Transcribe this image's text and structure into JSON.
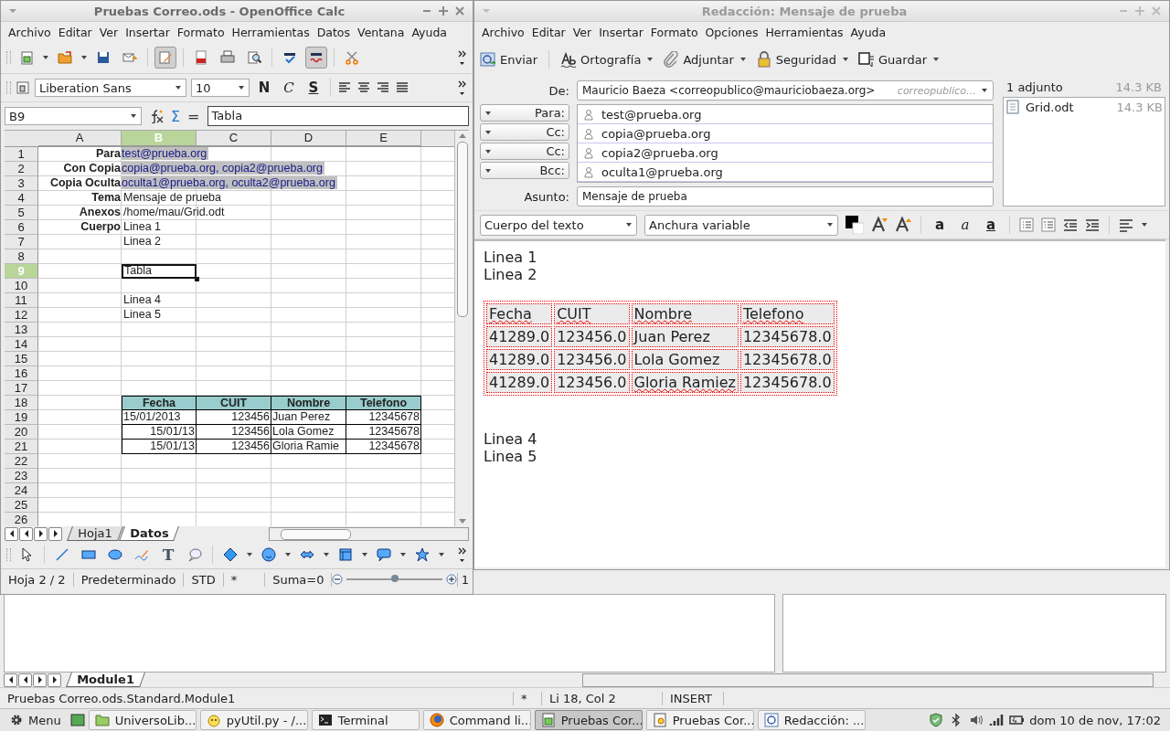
{
  "ide": {
    "tabs": [
      {
        "label": "Module1",
        "selected": true
      }
    ],
    "status": [
      "Pruebas Correo.ods.Standard.Module1",
      "*",
      "Li 18, Col 2",
      "INSERT"
    ]
  },
  "calc": {
    "title": "Pruebas Correo.ods - OpenOffice Calc",
    "menu": [
      "Archivo",
      "Editar",
      "Ver",
      "Insertar",
      "Formato",
      "Herramientas",
      "Datos",
      "Ventana",
      "Ayuda"
    ],
    "toolbar": [
      {
        "kind": "new",
        "pressed": false,
        "dropdown": true
      },
      {
        "kind": "open",
        "pressed": false,
        "dropdown": true
      },
      {
        "kind": "save",
        "pressed": false,
        "dropdown": false
      },
      {
        "kind": "mail",
        "pressed": false,
        "dropdown": false
      },
      {
        "kind": "edit",
        "pressed": true,
        "dropdown": false
      },
      {
        "kind": "pdf",
        "pressed": false,
        "dropdown": false
      },
      {
        "kind": "print",
        "pressed": false,
        "dropdown": false
      },
      {
        "kind": "preview",
        "pressed": false,
        "dropdown": false
      },
      {
        "kind": "spell",
        "pressed": false,
        "dropdown": false
      },
      {
        "kind": "autospell",
        "pressed": true,
        "dropdown": false
      },
      {
        "kind": "cut",
        "pressed": false,
        "dropdown": false
      }
    ],
    "font_name": "Liberation Sans",
    "font_size": "10",
    "style_buttons": [
      {
        "kind": "bold",
        "label": "N"
      },
      {
        "kind": "italic",
        "label": "C"
      },
      {
        "kind": "underline",
        "label": "S"
      }
    ],
    "cell_ref": "B9",
    "formula_symbols": [
      "Σ",
      "="
    ],
    "formula": "Tabla",
    "columns": [
      {
        "label": "A",
        "selected": false
      },
      {
        "label": "B",
        "selected": true
      },
      {
        "label": "C",
        "selected": false
      },
      {
        "label": "D",
        "selected": false
      },
      {
        "label": "E",
        "selected": false
      }
    ],
    "rows": [
      {
        "number": "1",
        "selected": false,
        "cells": [
          {
            "kind": "label",
            "text": "Para",
            "selected": false
          },
          {
            "kind": "link",
            "text": "test@prueba.org",
            "selected": false
          }
        ]
      },
      {
        "number": "2",
        "selected": false,
        "cells": [
          {
            "kind": "label",
            "text": "Con Copia",
            "selected": false
          },
          {
            "kind": "link",
            "text": "copia@prueba.org, copia2@prueba.org",
            "selected": false
          }
        ]
      },
      {
        "number": "3",
        "selected": false,
        "cells": [
          {
            "kind": "label",
            "text": "Copia Oculta",
            "selected": false
          },
          {
            "kind": "link",
            "text": "oculta1@prueba.org, oculta2@prueba.org",
            "selected": false
          }
        ]
      },
      {
        "number": "4",
        "selected": false,
        "cells": [
          {
            "kind": "label",
            "text": "Tema",
            "selected": false
          },
          {
            "kind": "text",
            "text": "Mensaje de prueba",
            "selected": false
          }
        ]
      },
      {
        "number": "5",
        "selected": false,
        "cells": [
          {
            "kind": "label",
            "text": "Anexos",
            "selected": false
          },
          {
            "kind": "text",
            "text": "/home/mau/Grid.odt",
            "selected": false
          }
        ]
      },
      {
        "number": "6",
        "selected": false,
        "cells": [
          {
            "kind": "label",
            "text": "Cuerpo",
            "selected": false
          },
          {
            "kind": "text",
            "text": "Linea 1",
            "selected": false
          }
        ]
      },
      {
        "number": "7",
        "selected": false,
        "cells": [
          {
            "kind": "empty"
          },
          {
            "kind": "text",
            "text": "Linea 2",
            "selected": false
          }
        ]
      },
      {
        "number": "8",
        "selected": false
      },
      {
        "number": "9",
        "selected": true,
        "cells": [
          {
            "kind": "empty"
          },
          {
            "kind": "text",
            "text": "Tabla",
            "selected": true
          }
        ]
      },
      {
        "number": "10",
        "selected": false
      },
      {
        "number": "11",
        "selected": false,
        "cells": [
          {
            "kind": "empty"
          },
          {
            "kind": "text",
            "text": "Linea 4",
            "selected": false
          }
        ]
      },
      {
        "number": "12",
        "selected": false,
        "cells": [
          {
            "kind": "empty"
          },
          {
            "kind": "text",
            "text": "Linea 5",
            "selected": false
          }
        ]
      },
      {
        "number": "13",
        "selected": false
      },
      {
        "number": "14",
        "selected": false
      },
      {
        "number": "15",
        "selected": false
      },
      {
        "number": "16",
        "selected": false
      },
      {
        "number": "17",
        "selected": false
      },
      {
        "number": "18",
        "selected": false,
        "cells": [
          {
            "kind": "empty"
          },
          {
            "kind": "th",
            "text": "Fecha",
            "selected": false
          },
          {
            "kind": "th",
            "text": "CUIT",
            "selected": false
          },
          {
            "kind": "th",
            "text": "Nombre",
            "selected": false
          },
          {
            "kind": "th",
            "text": "Telefono",
            "selected": false
          }
        ]
      },
      {
        "number": "19",
        "selected": false,
        "cells": [
          {
            "kind": "empty"
          },
          {
            "kind": "td",
            "text": "15/01/2013",
            "selected": false
          },
          {
            "kind": "tdnum",
            "text": "123456",
            "selected": false
          },
          {
            "kind": "td",
            "text": "Juan Perez",
            "selected": false
          },
          {
            "kind": "tdnum",
            "text": "12345678",
            "selected": false
          }
        ]
      },
      {
        "number": "20",
        "selected": false,
        "cells": [
          {
            "kind": "empty"
          },
          {
            "kind": "tdnum",
            "text": "15/01/13",
            "selected": false
          },
          {
            "kind": "tdnum",
            "text": "123456",
            "selected": false
          },
          {
            "kind": "td",
            "text": "Lola Gomez",
            "selected": false
          },
          {
            "kind": "tdnum",
            "text": "12345678",
            "selected": false
          }
        ]
      },
      {
        "number": "21",
        "selected": false,
        "cells": [
          {
            "kind": "empty"
          },
          {
            "kind": "tdnum",
            "text": "15/01/13",
            "selected": false
          },
          {
            "kind": "tdnum",
            "text": "123456",
            "selected": false
          },
          {
            "kind": "td",
            "text": "Gloria Ramie",
            "selected": false
          },
          {
            "kind": "tdnum",
            "text": "12345678",
            "selected": false
          }
        ]
      },
      {
        "number": "22",
        "selected": false
      },
      {
        "number": "23",
        "selected": false
      },
      {
        "number": "24",
        "selected": false
      },
      {
        "number": "25",
        "selected": false
      },
      {
        "number": "26",
        "selected": false
      }
    ],
    "sheet_tabs": [
      {
        "label": "Hoja1",
        "selected": false
      },
      {
        "label": "Datos",
        "selected": true
      }
    ],
    "draw_tools": [
      {
        "kind": "select"
      },
      {
        "kind": "line"
      },
      {
        "kind": "rect"
      },
      {
        "kind": "ellipse"
      },
      {
        "kind": "freeform"
      },
      {
        "kind": "text",
        "label": "T"
      },
      {
        "kind": "callout"
      },
      {
        "kind": "diamond"
      },
      {
        "kind": "smiley"
      },
      {
        "kind": "arrows"
      },
      {
        "kind": "flowchart"
      },
      {
        "kind": "bubble"
      },
      {
        "kind": "star"
      }
    ],
    "status": [
      "Hoja 2 / 2",
      "Predeterminado",
      "STD",
      "*",
      "Suma=0"
    ],
    "zoom": {
      "level": 0.5
    },
    "zoom_reading": "1"
  },
  "composer": {
    "title": "Redacción: Mensaje de prueba",
    "menu": [
      "Archivo",
      "Editar",
      "Ver",
      "Insertar",
      "Formato",
      "Opciones",
      "Herramientas",
      "Ayuda"
    ],
    "toolbar": [
      {
        "kind": "send",
        "label": "Enviar",
        "dropdown": false
      },
      {
        "kind": "spelling",
        "label": "Ortografía",
        "dropdown": true
      },
      {
        "kind": "attach",
        "label": "Adjuntar",
        "dropdown": true
      },
      {
        "kind": "security",
        "label": "Seguridad",
        "dropdown": true
      },
      {
        "kind": "save",
        "label": "Guardar",
        "dropdown": true
      }
    ],
    "from_label": "De:",
    "from": "Mauricio Baeza <correopublico@mauriciobaeza.org>",
    "from_identity": "correopublico…",
    "recipients": [
      {
        "type": "Para:",
        "address": "test@prueba.org"
      },
      {
        "type": "Cc:",
        "address": "copia@prueba.org"
      },
      {
        "type": "Cc:",
        "address": "copia2@prueba.org"
      },
      {
        "type": "Bcc:",
        "address": "oculta1@prueba.org"
      }
    ],
    "subject_label": "Asunto:",
    "subject": "Mensaje de prueba",
    "attachments_header": "1 adjunto",
    "attachments_size": "14.3 KB",
    "attachments": [
      {
        "name": "Grid.odt",
        "size": "14.3 KB"
      }
    ],
    "paragraph_style": "Cuerpo del texto",
    "font": "Anchura variable",
    "text_styles": [
      {
        "kind": "bold",
        "label": "a"
      },
      {
        "kind": "italic",
        "label": "a"
      },
      {
        "kind": "underline",
        "label": "a"
      }
    ],
    "body": [
      {
        "kind": "line",
        "text": "Linea 1"
      },
      {
        "kind": "line",
        "text": "Linea 2"
      },
      {
        "kind": "blank"
      },
      {
        "kind": "table",
        "rows": [
          [
            {
              "text": "Fecha",
              "misspelled": true
            },
            {
              "text": "CUIT",
              "misspelled": true
            },
            {
              "text": "Nombre",
              "misspelled": true
            },
            {
              "text": "Telefono",
              "misspelled": true
            }
          ],
          [
            {
              "text": "41289.0",
              "misspelled": false
            },
            {
              "text": "123456.0",
              "misspelled": false
            },
            {
              "text": "Juan Perez",
              "misspelled": false
            },
            {
              "text": "12345678.0",
              "misspelled": false
            }
          ],
          [
            {
              "text": "41289.0",
              "misspelled": false
            },
            {
              "text": "123456.0",
              "misspelled": false
            },
            {
              "text": "Lola Gomez",
              "misspelled": false
            },
            {
              "text": "12345678.0",
              "misspelled": false
            }
          ],
          [
            {
              "text": "41289.0",
              "misspelled": false
            },
            {
              "text": "123456.0",
              "misspelled": false
            },
            {
              "text": "Gloria Ramiez",
              "misspelled": true
            },
            {
              "text": "12345678.0",
              "misspelled": false
            }
          ]
        ]
      },
      {
        "kind": "blank"
      },
      {
        "kind": "blank"
      },
      {
        "kind": "line",
        "text": "Linea 4"
      },
      {
        "kind": "line",
        "text": "Linea 5"
      }
    ]
  },
  "taskbar": {
    "menu": "Menu",
    "tasks": [
      {
        "kind": "folder",
        "label": "UniversoLib...",
        "selected": false
      },
      {
        "kind": "editor",
        "label": "pyUtil.py - /...",
        "selected": false
      },
      {
        "kind": "terminal",
        "label": "Terminal",
        "selected": false
      },
      {
        "kind": "browser",
        "label": "Command li...",
        "selected": false
      },
      {
        "kind": "sheet",
        "label": "Pruebas Cor...",
        "selected": true
      },
      {
        "kind": "office",
        "label": "Pruebas Cor...",
        "selected": false
      },
      {
        "kind": "mail",
        "label": "Redacción: ...",
        "selected": false
      }
    ],
    "clock": "dom 10 de nov, 17:02"
  }
}
